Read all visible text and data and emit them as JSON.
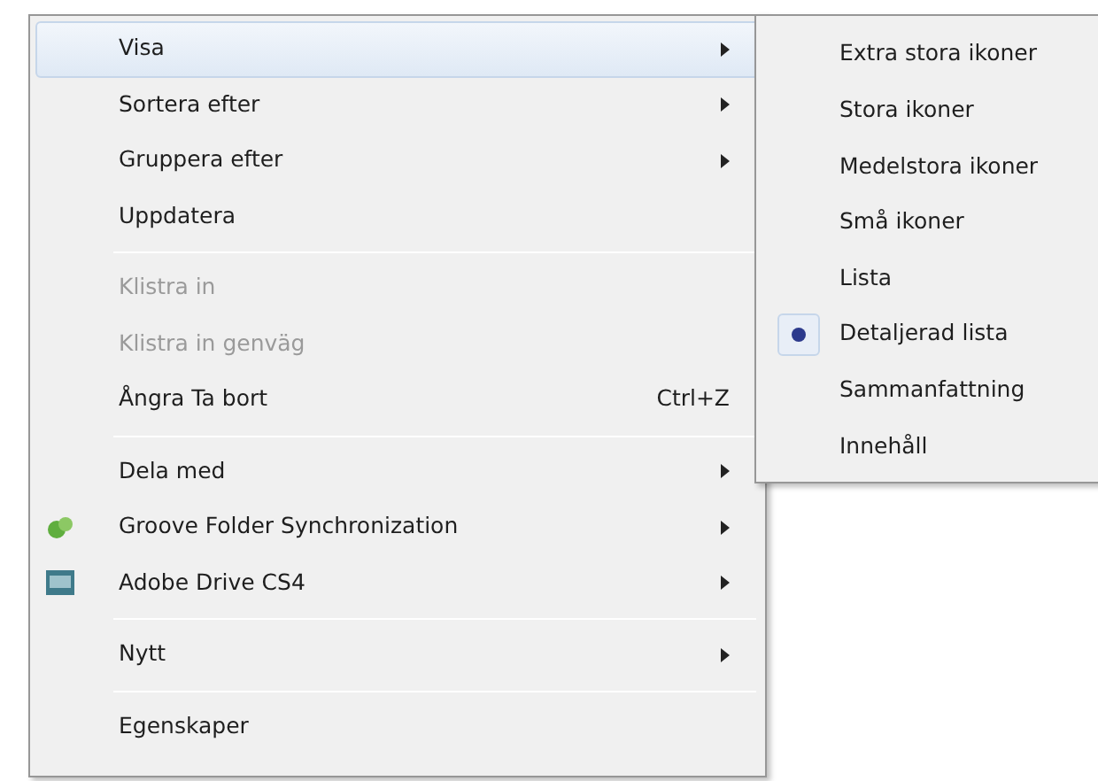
{
  "context_menu": {
    "items": [
      {
        "kind": "item",
        "label": "Visa",
        "submenu": true,
        "selected": true,
        "disabled": false
      },
      {
        "kind": "item",
        "label": "Sortera efter",
        "submenu": true,
        "selected": false,
        "disabled": false
      },
      {
        "kind": "item",
        "label": "Gruppera efter",
        "submenu": true,
        "selected": false,
        "disabled": false
      },
      {
        "kind": "item",
        "label": "Uppdatera",
        "submenu": false,
        "selected": false,
        "disabled": false
      },
      {
        "kind": "separator"
      },
      {
        "kind": "item",
        "label": "Klistra in",
        "submenu": false,
        "selected": false,
        "disabled": true
      },
      {
        "kind": "item",
        "label": "Klistra in genväg",
        "submenu": false,
        "selected": false,
        "disabled": true
      },
      {
        "kind": "item",
        "label": "Ångra Ta bort",
        "shortcut": "Ctrl+Z",
        "submenu": false,
        "selected": false,
        "disabled": false
      },
      {
        "kind": "separator"
      },
      {
        "kind": "item",
        "label": "Dela med",
        "submenu": true,
        "selected": false,
        "disabled": false
      },
      {
        "kind": "sync_item",
        "label": "Groove Folder Synchronization",
        "submenu": true,
        "selected": false,
        "disabled": false
      },
      {
        "kind": "drive_item",
        "label": "Adobe Drive CS4",
        "submenu": true,
        "selected": false,
        "disabled": false
      },
      {
        "kind": "separator"
      },
      {
        "kind": "item",
        "label": "Nytt",
        "submenu": true,
        "selected": false,
        "disabled": false
      },
      {
        "kind": "separator"
      },
      {
        "kind": "item",
        "label": "Egenskaper",
        "submenu": false,
        "selected": false,
        "disabled": false
      }
    ]
  },
  "view_submenu": {
    "items": [
      {
        "label": "Extra stora ikoner",
        "selected": false
      },
      {
        "label": "Stora ikoner",
        "selected": false
      },
      {
        "label": "Medelstora ikoner",
        "selected": false
      },
      {
        "label": "Små ikoner",
        "selected": false
      },
      {
        "label": "Lista",
        "selected": false
      },
      {
        "label": "Detaljerad lista",
        "selected": true
      },
      {
        "label": "Sammanfattning",
        "selected": false
      },
      {
        "label": "Innehåll",
        "selected": false
      }
    ]
  }
}
